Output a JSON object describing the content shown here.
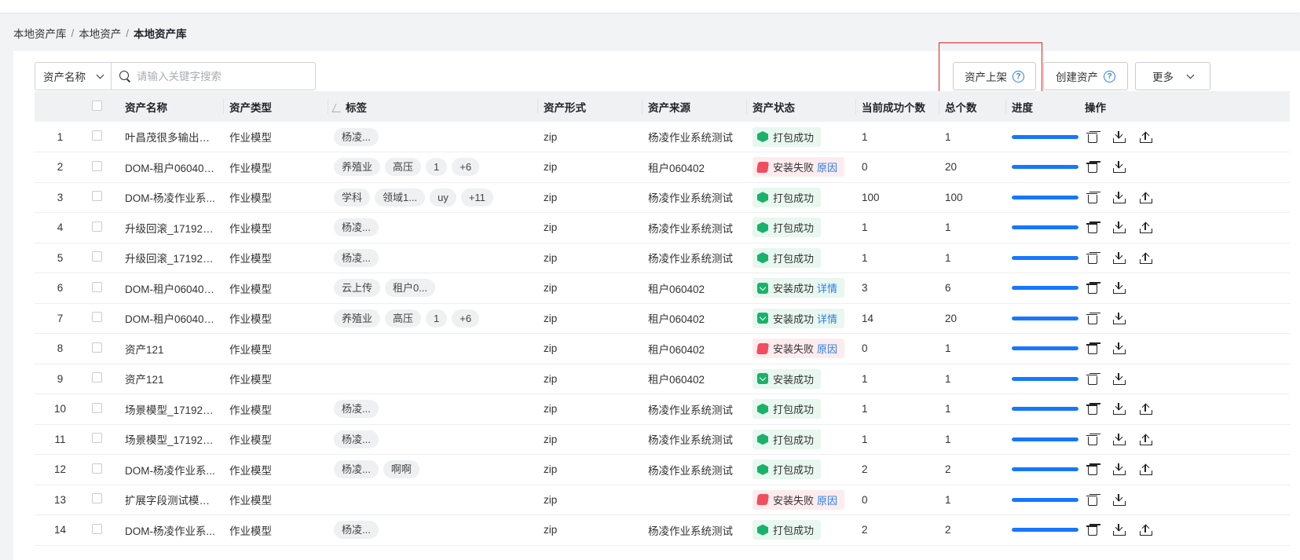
{
  "breadcrumb": [
    "本地资产库",
    "本地资产",
    "本地资产库"
  ],
  "toolbar": {
    "select_value": "资产名称",
    "search_placeholder": "请输入关键字搜索",
    "btn_shelf": "资产上架",
    "btn_create": "创建资产",
    "btn_more": "更多"
  },
  "columns": {
    "name": "资产名称",
    "type": "资产类型",
    "tags": "标签",
    "format": "资产形式",
    "source": "资产来源",
    "status": "资产状态",
    "success": "当前成功个数",
    "total": "总个数",
    "progress": "进度",
    "ops": "操作"
  },
  "colors": {
    "accent": "#1677ff",
    "success": "#18b26a",
    "fail": "#f04e5e",
    "highlight": "#e0201b"
  },
  "rows": [
    {
      "idx": "1",
      "name": "叶昌茂很多输出项...",
      "type": "作业模型",
      "tags": [
        "杨凌..."
      ],
      "format": "zip",
      "source": "杨凌作业系统测试",
      "status": "打包成功",
      "status_kind": "pack",
      "link": "",
      "success": "1",
      "total": "1",
      "progress": 1.0,
      "ops": [
        "delete",
        "download",
        "upload"
      ]
    },
    {
      "idx": "2",
      "name": "DOM-租户060402...",
      "type": "作业模型",
      "tags": [
        "养殖业",
        "高压",
        "1",
        "+6"
      ],
      "format": "zip",
      "source": "租户060402",
      "status": "安装失败",
      "status_kind": "fail",
      "link": "原因",
      "success": "0",
      "total": "20",
      "progress": 1.0,
      "ops": [
        "delete",
        "download"
      ]
    },
    {
      "idx": "3",
      "name": "DOM-杨凌作业系...",
      "type": "作业模型",
      "tags": [
        "学科",
        "领域1...",
        "uy",
        "+11"
      ],
      "format": "zip",
      "source": "杨凌作业系统测试",
      "status": "打包成功",
      "status_kind": "pack",
      "link": "",
      "success": "100",
      "total": "100",
      "progress": 1.0,
      "ops": [
        "delete",
        "download",
        "upload"
      ]
    },
    {
      "idx": "4",
      "name": "升级回滚_171929...",
      "type": "作业模型",
      "tags": [
        "杨凌..."
      ],
      "format": "zip",
      "source": "杨凌作业系统测试",
      "status": "打包成功",
      "status_kind": "pack",
      "link": "",
      "success": "1",
      "total": "1",
      "progress": 1.0,
      "ops": [
        "delete",
        "download",
        "upload"
      ]
    },
    {
      "idx": "5",
      "name": "升级回滚_171929...",
      "type": "作业模型",
      "tags": [
        "杨凌..."
      ],
      "format": "zip",
      "source": "杨凌作业系统测试",
      "status": "打包成功",
      "status_kind": "pack",
      "link": "",
      "success": "1",
      "total": "1",
      "progress": 1.0,
      "ops": [
        "delete",
        "download",
        "upload"
      ]
    },
    {
      "idx": "6",
      "name": "DOM-租户060402...",
      "type": "作业模型",
      "tags": [
        "云上传",
        "租户0..."
      ],
      "format": "zip",
      "source": "租户060402",
      "status": "安装成功",
      "status_kind": "ok",
      "link": "详情",
      "success": "3",
      "total": "6",
      "progress": 1.0,
      "ops": [
        "delete",
        "download"
      ]
    },
    {
      "idx": "7",
      "name": "DOM-租户060402...",
      "type": "作业模型",
      "tags": [
        "养殖业",
        "高压",
        "1",
        "+6"
      ],
      "format": "zip",
      "source": "租户060402",
      "status": "安装成功",
      "status_kind": "ok",
      "link": "详情",
      "success": "14",
      "total": "20",
      "progress": 1.0,
      "ops": [
        "delete",
        "download"
      ]
    },
    {
      "idx": "8",
      "name": "资产121",
      "type": "作业模型",
      "tags": [],
      "format": "zip",
      "source": "租户060402",
      "status": "安装失败",
      "status_kind": "fail",
      "link": "原因",
      "success": "0",
      "total": "1",
      "progress": 1.0,
      "ops": [
        "delete",
        "download"
      ]
    },
    {
      "idx": "9",
      "name": "资产121",
      "type": "作业模型",
      "tags": [],
      "format": "zip",
      "source": "租户060402",
      "status": "安装成功",
      "status_kind": "ok",
      "link": "",
      "success": "1",
      "total": "1",
      "progress": 1.0,
      "ops": [
        "delete",
        "download"
      ]
    },
    {
      "idx": "10",
      "name": "场景模型_171921...",
      "type": "作业模型",
      "tags": [
        "杨凌..."
      ],
      "format": "zip",
      "source": "杨凌作业系统测试",
      "status": "打包成功",
      "status_kind": "pack",
      "link": "",
      "success": "1",
      "total": "1",
      "progress": 1.0,
      "ops": [
        "delete",
        "download",
        "upload"
      ]
    },
    {
      "idx": "11",
      "name": "场景模型_171921...",
      "type": "作业模型",
      "tags": [
        "杨凌..."
      ],
      "format": "zip",
      "source": "杨凌作业系统测试",
      "status": "打包成功",
      "status_kind": "pack",
      "link": "",
      "success": "1",
      "total": "1",
      "progress": 1.0,
      "ops": [
        "delete",
        "download",
        "upload"
      ]
    },
    {
      "idx": "12",
      "name": "DOM-杨凌作业系...",
      "type": "作业模型",
      "tags": [
        "杨凌...",
        "啊啊"
      ],
      "format": "zip",
      "source": "杨凌作业系统测试",
      "status": "打包成功",
      "status_kind": "pack",
      "link": "",
      "success": "2",
      "total": "2",
      "progress": 1.0,
      "ops": [
        "delete",
        "download",
        "upload"
      ]
    },
    {
      "idx": "13",
      "name": "扩展字段测试模版...",
      "type": "作业模型",
      "tags": [],
      "format": "zip",
      "source": "",
      "status": "安装失败",
      "status_kind": "fail",
      "link": "原因",
      "success": "0",
      "total": "1",
      "progress": 1.0,
      "ops": [
        "delete",
        "download"
      ]
    },
    {
      "idx": "14",
      "name": "DOM-杨凌作业系...",
      "type": "作业模型",
      "tags": [
        "杨凌..."
      ],
      "format": "zip",
      "source": "杨凌作业系统测试",
      "status": "打包成功",
      "status_kind": "pack",
      "link": "",
      "success": "2",
      "total": "2",
      "progress": 1.0,
      "ops": [
        "delete",
        "download",
        "upload"
      ]
    }
  ]
}
